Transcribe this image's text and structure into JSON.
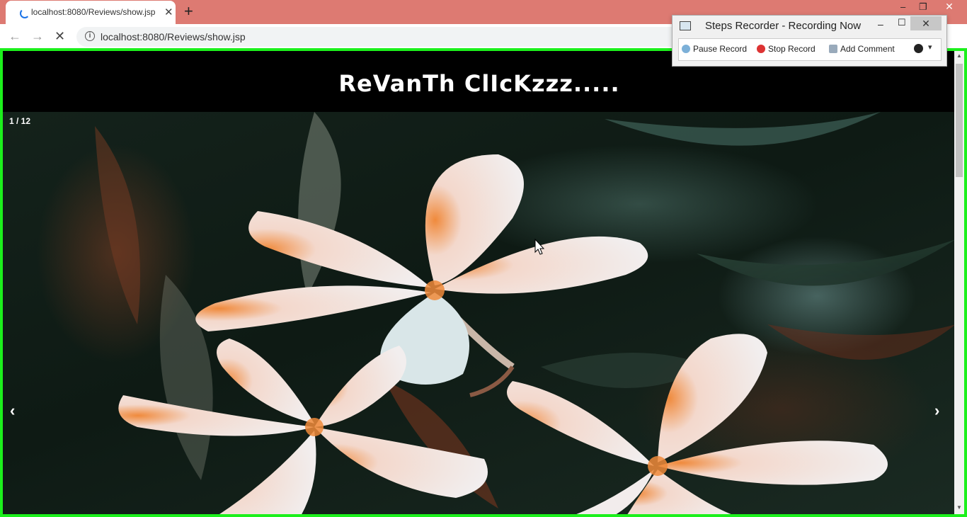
{
  "browser": {
    "tab_title": "localhost:8080/Reviews/show.jsp",
    "tab_close": "✕",
    "new_tab": "+",
    "url": "localhost:8080/Reviews/show.jsp",
    "back_icon": "←",
    "forward_icon": "→",
    "stop_icon": "✕",
    "info_icon": "i",
    "minimize": "–",
    "restore": "❐",
    "close": "✕"
  },
  "page": {
    "title": "ReVanTh ClIcKzzz.....",
    "slide_counter": "1 / 12",
    "prev_arrow": "‹",
    "next_arrow": "›"
  },
  "recorder": {
    "title": "Steps Recorder - Recording Now",
    "minimize": "–",
    "maximize": "☐",
    "close": "✕",
    "pause": "Pause Record",
    "stop": "Stop Record",
    "comment": "Add Comment",
    "more": "▾"
  },
  "colors": {
    "tabstrip": "#dd7a72",
    "frame": "#1cf01c",
    "header": "#000000"
  }
}
